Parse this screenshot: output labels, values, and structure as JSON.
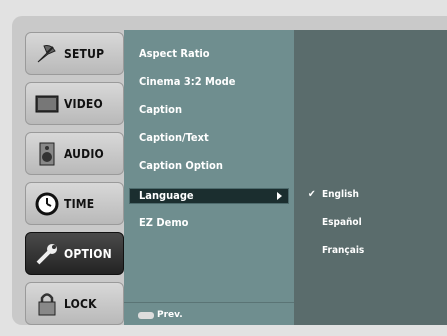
{
  "tabs": [
    {
      "label": "SETUP",
      "icon": "satellite-dish-icon"
    },
    {
      "label": "VIDEO",
      "icon": "tv-screen-icon"
    },
    {
      "label": "AUDIO",
      "icon": "speaker-icon"
    },
    {
      "label": "TIME",
      "icon": "clock-icon"
    },
    {
      "label": "OPTION",
      "icon": "wrench-icon",
      "active": true
    },
    {
      "label": "LOCK",
      "icon": "padlock-icon"
    }
  ],
  "menu": {
    "items": [
      "Aspect Ratio",
      "Cinema 3:2 Mode",
      "Caption",
      "Caption/Text",
      "Caption Option",
      "Language",
      "EZ Demo"
    ],
    "selected": "Language",
    "prev_label": "Prev."
  },
  "submenu": {
    "items": [
      "English",
      "Español",
      "Français"
    ],
    "checked": "English"
  },
  "colors": {
    "menu_bg": "#6f8e8f",
    "submenu_bg": "#5a6c6c",
    "active_tab": "#2a2a2a"
  }
}
